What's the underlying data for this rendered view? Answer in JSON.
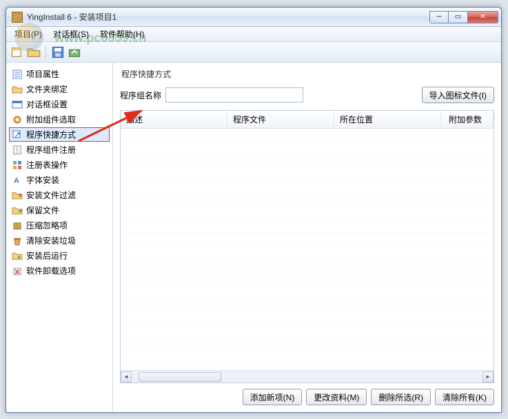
{
  "window": {
    "title": "YingInstall 6 - 安装项目1"
  },
  "menu": {
    "project": "项目(P)",
    "dialog": "对话框(S)",
    "help": "软件帮助(H)"
  },
  "watermark": {
    "text": "www.pc0359.cn"
  },
  "sidebar": {
    "items": [
      {
        "label": "项目属性"
      },
      {
        "label": "文件夹绑定"
      },
      {
        "label": "对话框设置"
      },
      {
        "label": "附加组件选取"
      },
      {
        "label": "程序快捷方式"
      },
      {
        "label": "程序组件注册"
      },
      {
        "label": "注册表操作"
      },
      {
        "label": "字体安装"
      },
      {
        "label": "安装文件过滤"
      },
      {
        "label": "保留文件"
      },
      {
        "label": "压缩忽略项"
      },
      {
        "label": "清除安装垃圾"
      },
      {
        "label": "安装后运行"
      },
      {
        "label": "软件卸载选项"
      }
    ]
  },
  "main": {
    "title": "程序快捷方式",
    "group_label": "程序组名称",
    "group_value": "",
    "import_btn": "导入图标文件(I)",
    "columns": {
      "desc": "描述",
      "file": "程序文件",
      "loc": "所在位置",
      "arg": "附加参数"
    },
    "buttons": {
      "add": "添加新项(N)",
      "edit": "更改资料(M)",
      "delsel": "删除所选(R)",
      "clear": "清除所有(K)"
    }
  }
}
